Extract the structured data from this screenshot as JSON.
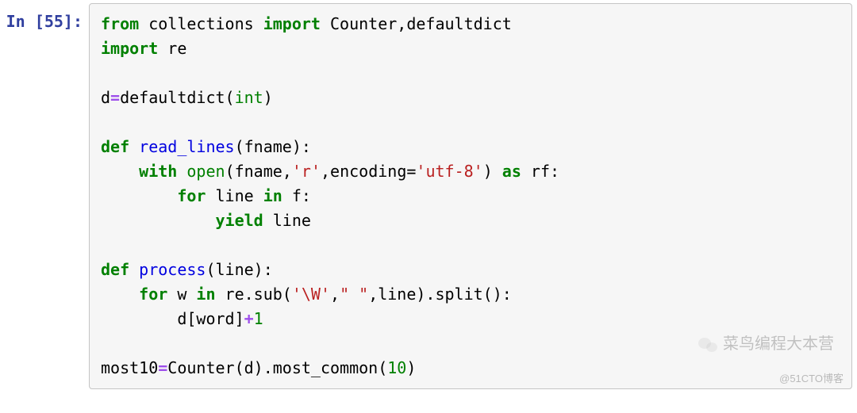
{
  "prompt": {
    "label_prefix": "In [",
    "number": "55",
    "label_suffix": "]:"
  },
  "code": {
    "l1": {
      "a": "from",
      "b": "collections",
      "c": "import",
      "d": "Counter,defaultdict"
    },
    "l2": {
      "a": "import",
      "b": "re"
    },
    "l3": "",
    "l4": {
      "a": "d",
      "b": "=",
      "c": "defaultdict(",
      "d": "int",
      "e": ")"
    },
    "l5": "",
    "l6": {
      "a": "def",
      "b": "read_lines",
      "c": "(fname):"
    },
    "l7": {
      "ind": "    ",
      "a": "with",
      "b": "open",
      "c": "(fname,",
      "d": "'r'",
      "e": ",encoding=",
      "f": "'utf-8'",
      "g": ") ",
      "h": "as",
      "i": " rf:"
    },
    "l8": {
      "ind": "        ",
      "a": "for",
      "b": " line ",
      "c": "in",
      "d": " f:"
    },
    "l9": {
      "ind": "            ",
      "a": "yield",
      "b": " line"
    },
    "l10": "",
    "l11": {
      "a": "def",
      "b": "process",
      "c": "(line):"
    },
    "l12": {
      "ind": "    ",
      "a": "for",
      "b": " w ",
      "c": "in",
      "d": " re.sub(",
      "e": "'\\W'",
      "f": ",",
      "g": "\" \"",
      "h": ",line).split():"
    },
    "l13": {
      "ind": "        ",
      "a": "d[word]",
      "b": "+",
      "c": "1"
    },
    "l14": "",
    "l15": {
      "a": "most10",
      "b": "=",
      "c": "Counter(d).most_common(",
      "d": "10",
      "e": ")"
    }
  },
  "watermark": {
    "top": "菜鸟编程大本营",
    "bottom": "@51CTO博客"
  }
}
